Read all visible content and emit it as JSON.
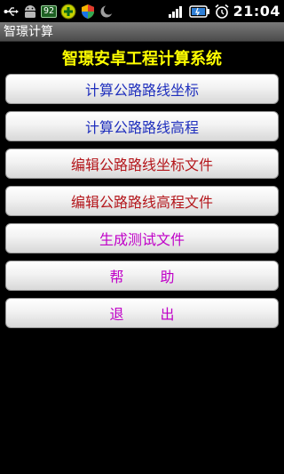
{
  "status": {
    "battery_level": "92",
    "time": "21:04"
  },
  "window": {
    "title": "智璟计算"
  },
  "header": {
    "title": "智璟安卓工程计算系统"
  },
  "menu": {
    "items": [
      {
        "label": "计算公路路线坐标"
      },
      {
        "label": "计算公路路线高程"
      },
      {
        "label": "编辑公路路线坐标文件"
      },
      {
        "label": "编辑公路路线高程文件"
      },
      {
        "label": "生成测试文件"
      },
      {
        "label": "帮 助"
      },
      {
        "label": "退 出"
      }
    ]
  },
  "colors": {
    "header_text": "#ffff00",
    "blue_text": "#1f2fbd",
    "red_text": "#b4161b",
    "purple_text": "#c000c8"
  }
}
